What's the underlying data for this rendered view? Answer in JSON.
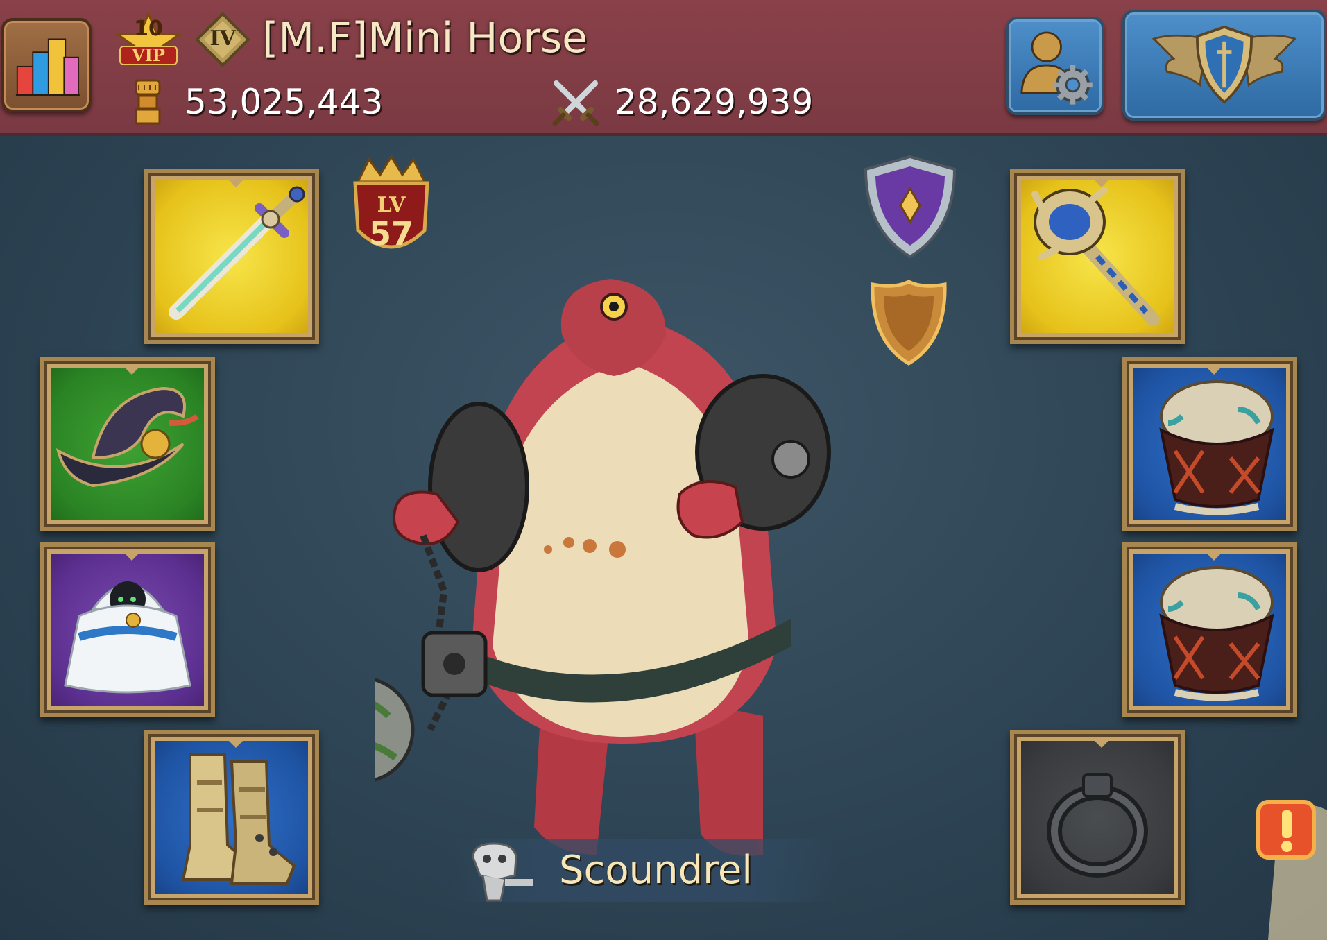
{
  "header": {
    "vip_level": "10",
    "vip_label": "VIP",
    "rank": "IV",
    "player_name": "[M.F]Mini Horse",
    "power": "53,025,443",
    "kills": "28,629,939"
  },
  "hero": {
    "level_prefix": "LV",
    "level": "57",
    "title": "Scoundrel"
  },
  "equipment": [
    {
      "slot": "weapon",
      "icon": "sword-icon",
      "rarity": "legendary",
      "color": "#e6c21a"
    },
    {
      "slot": "helmet",
      "icon": "witch-hat-icon",
      "rarity": "uncommon",
      "color": "#2a8324"
    },
    {
      "slot": "chest",
      "icon": "fur-cloak-icon",
      "rarity": "epic",
      "color": "#5b2f8f"
    },
    {
      "slot": "boots",
      "icon": "boots-icon",
      "rarity": "rare",
      "color": "#1f54a4"
    },
    {
      "slot": "offhand",
      "icon": "mace-icon",
      "rarity": "legendary",
      "color": "#e6c21a"
    },
    {
      "slot": "accessory-1",
      "icon": "war-drum-icon",
      "rarity": "rare",
      "color": "#1f54a4"
    },
    {
      "slot": "accessory-2",
      "icon": "war-drum-icon",
      "rarity": "rare",
      "color": "#1f54a4"
    },
    {
      "slot": "ring",
      "icon": "ring-icon",
      "rarity": "empty",
      "color": "#393b3e"
    }
  ],
  "icons": {
    "stats": "bar-chart-icon",
    "profile": "profile-settings-icon",
    "guild": "winged-shield-icon",
    "power": "fist-icon",
    "kills": "crossed-swords-icon",
    "title_badge": "purple-shield-icon",
    "guild_badge": "bronze-shield-icon",
    "title": "skull-icon",
    "alert": "exclamation-icon"
  },
  "colors": {
    "header_bg": "#7a3a43",
    "button_blue": "#2e6aa4",
    "frame_gold": "#a7864f",
    "text_cream": "#f6e8c4"
  }
}
